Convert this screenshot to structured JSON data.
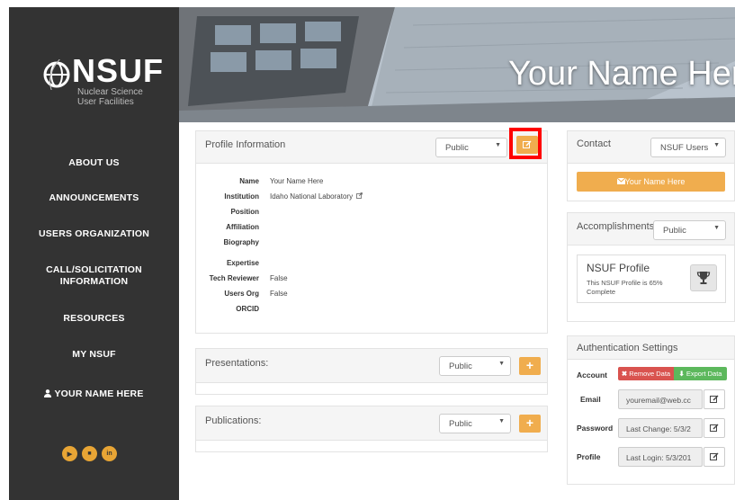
{
  "app": {
    "logo_word": "NSUF",
    "logo_subtitle_line1": "Nuclear Science",
    "logo_subtitle_line2": "User Facilities"
  },
  "sidebar": {
    "items": [
      {
        "label": "ABOUT US"
      },
      {
        "label": "ANNOUNCEMENTS"
      },
      {
        "label": "USERS ORGANIZATION"
      },
      {
        "label": "CALL/SOLICITATION"
      },
      {
        "label": "INFORMATION"
      },
      {
        "label": "RESOURCES"
      },
      {
        "label": "MY NSUF"
      },
      {
        "label": "YOUR NAME HERE"
      }
    ],
    "social_icons": [
      "youtube-icon",
      "video-icon",
      "linkedin-icon"
    ]
  },
  "banner": {
    "title": "Your Name Here"
  },
  "profile": {
    "title": "Profile Information",
    "visibility": "Public",
    "edit_icon": "edit-icon",
    "fields": [
      {
        "label": "Name",
        "value": "Your Name Here"
      },
      {
        "label": "Institution",
        "value": "Idaho National Laboratory"
      },
      {
        "label": "Position",
        "value": ""
      },
      {
        "label": "Affiliation",
        "value": ""
      },
      {
        "label": "Biography",
        "value": ""
      },
      {
        "label": "Expertise",
        "value": ""
      },
      {
        "label": "Tech Reviewer",
        "value": "False"
      },
      {
        "label": "Users Org",
        "value": "False"
      },
      {
        "label": "ORCID",
        "value": ""
      }
    ]
  },
  "presentations": {
    "title": "Presentations:",
    "visibility": "Public",
    "add_label": "+"
  },
  "publications": {
    "title": "Publications:",
    "visibility": "Public",
    "add_label": "+"
  },
  "contact": {
    "title": "Contact",
    "visibility": "NSUF Users",
    "button_label": "Your Name Here"
  },
  "accomplishments": {
    "title": "Accomplishments",
    "visibility": "Public",
    "card_title": "NSUF Profile",
    "card_text_line1": "This NSUF Profile is 65%",
    "card_text_line2": "Complete"
  },
  "auth": {
    "title": "Authentication Settings",
    "account_label": "Account",
    "remove_label": "Remove Data",
    "export_label": "Export Data",
    "rows": [
      {
        "label": "Email",
        "value": "youremail@web.cc"
      },
      {
        "label": "Password",
        "value": "Last Change: 5/3/2"
      },
      {
        "label": "Profile",
        "value": "Last Login: 5/3/201"
      }
    ]
  },
  "colors": {
    "sidebar": "#333333",
    "accent": "#f0ad4e",
    "danger": "#d9534f",
    "success": "#5cb85c",
    "highlight": "#ff0000"
  }
}
